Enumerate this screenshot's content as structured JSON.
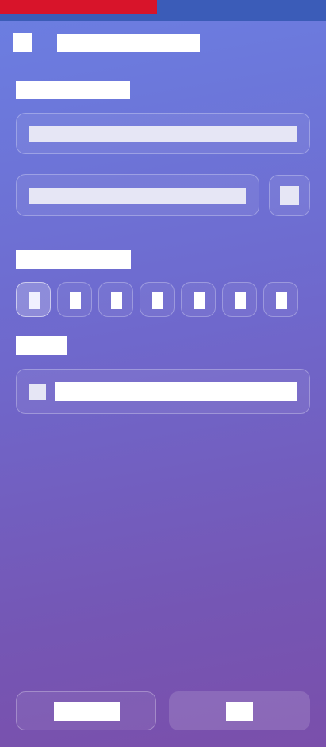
{
  "colors": {
    "background_top": "#6b7fe2",
    "background_bottom": "#7a4fab",
    "status_strip": "#3b5cb8",
    "alert_strip": "#d8142a"
  },
  "header": {
    "back_icon": "back-icon",
    "title": ""
  },
  "form": {
    "field_1_label": "",
    "field_1_value": "",
    "field_2_value": "",
    "field_2_action_icon": "picker-icon",
    "day_selector_label": "",
    "days": [
      {
        "label": "",
        "selected": true
      },
      {
        "label": "",
        "selected": false
      },
      {
        "label": "",
        "selected": false
      },
      {
        "label": "",
        "selected": false
      },
      {
        "label": "",
        "selected": false
      },
      {
        "label": "",
        "selected": false
      },
      {
        "label": "",
        "selected": false
      }
    ],
    "option_label": "",
    "option_text": ""
  },
  "footer": {
    "secondary_button_label": "",
    "primary_button_label": ""
  }
}
